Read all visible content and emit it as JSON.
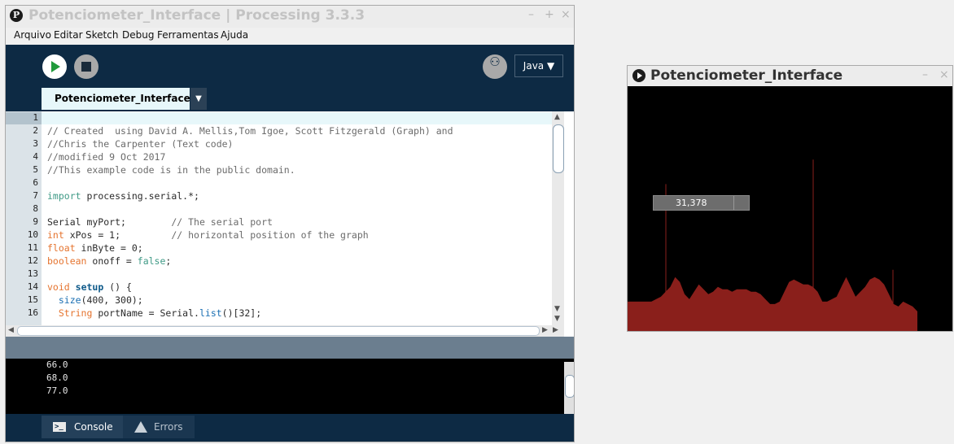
{
  "ide": {
    "title": "Potenciometer_Interface | Processing 3.3.3",
    "window_controls": [
      "–",
      "+",
      "×"
    ],
    "menu": [
      "Arquivo",
      "Editar",
      "Sketch",
      "Debug",
      "Ferramentas",
      "Ajuda"
    ],
    "mode": "Java ▼",
    "tab_name": "Potenciometer_Interface",
    "tab_menu_arrow": "▼",
    "line_numbers": [
      "1",
      "2",
      "3",
      "4",
      "5",
      "6",
      "7",
      "8",
      "9",
      "10",
      "11",
      "12",
      "13",
      "14",
      "15",
      "16"
    ],
    "code_lines": [
      "",
      "// Created  using David A. Mellis,Tom Igoe, Scott Fitzgerald (Graph) and",
      "//Chris the Carpenter (Text code)",
      "//modified 9 Oct 2017",
      "//This example code is in the public domain.",
      "",
      "import processing.serial.*;",
      "",
      "Serial myPort;        // The serial port",
      "int xPos = 1;         // horizontal position of the graph",
      "float inByte = 0;",
      "boolean onoff = false;",
      "",
      "void setup () {",
      "  size(400, 300);",
      "  String portName = Serial.list()[32];"
    ],
    "console_lines": [
      "66.0",
      "68.0",
      "77.0"
    ],
    "console_tab": "Console",
    "errors_tab": "Errors",
    "console_icon": ">_"
  },
  "sketch": {
    "title": "Potenciometer_Interface",
    "window_controls": [
      "–",
      "×"
    ],
    "readout": "31,378",
    "graph_color": "#8a1f1b",
    "graph_values": [
      0.12,
      0.12,
      0.12,
      0.12,
      0.12,
      0.12,
      0.13,
      0.14,
      0.16,
      0.18,
      0.22,
      0.2,
      0.15,
      0.13,
      0.16,
      0.19,
      0.17,
      0.15,
      0.16,
      0.18,
      0.17,
      0.17,
      0.16,
      0.17,
      0.17,
      0.17,
      0.16,
      0.16,
      0.15,
      0.13,
      0.11,
      0.11,
      0.12,
      0.16,
      0.2,
      0.21,
      0.2,
      0.19,
      0.19,
      0.18,
      0.16,
      0.12,
      0.12,
      0.13,
      0.14,
      0.18,
      0.22,
      0.18,
      0.14,
      0.16,
      0.18,
      0.21,
      0.22,
      0.21,
      0.19,
      0.15,
      0.11,
      0.1,
      0.12,
      0.11,
      0.1,
      0.08
    ]
  }
}
